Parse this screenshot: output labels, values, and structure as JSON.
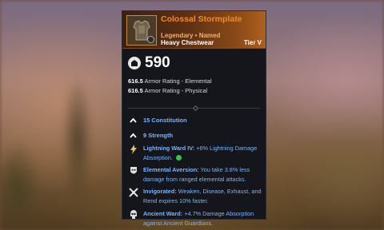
{
  "item": {
    "name": "Colossal Stormplate",
    "rarity": "Legendary • Named",
    "type": "Heavy Chestwear",
    "tier": "Tier V",
    "icon": "chestplate-icon"
  },
  "gear_score": "590",
  "armor": [
    {
      "value": "616.5",
      "label": "Armor Rating - Elemental"
    },
    {
      "value": "616.5",
      "label": "Armor Rating - Physical"
    }
  ],
  "attributes": [
    {
      "label": "15 Constitution",
      "icon": "chevron-up-icon"
    },
    {
      "label": "9 Strength",
      "icon": "chevron-up-icon"
    }
  ],
  "perks": [
    {
      "name": "Lightning Ward IV:",
      "desc": "+6% Lightning Damage Absorption.",
      "icon": "lightning-icon"
    },
    {
      "name": "Elemental Aversion:",
      "desc": "You take 3.8% less damage from ranged elemental attacks.",
      "icon": "mask-icon"
    },
    {
      "name": "Invigorated:",
      "desc": "Weaken, Disease, Exhaust, and Rend expires 10% faster.",
      "icon": "cross-swords-icon"
    },
    {
      "name": "Ancient Ward:",
      "desc": "+4.7% Damage Absorption against Ancient Guardians.",
      "icon": "skull-icon"
    }
  ],
  "colors": {
    "legendary_orange": "#f08a2c",
    "perk_blue": "#7ab4ff",
    "socket_green": "#3ac24a"
  }
}
